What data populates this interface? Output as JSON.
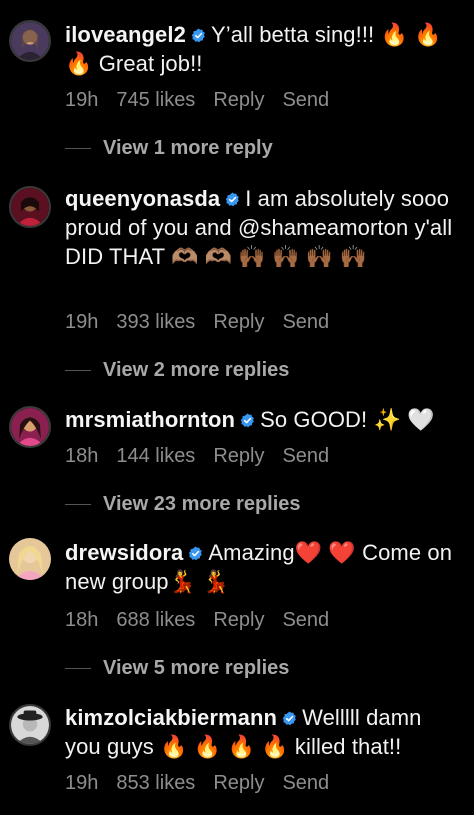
{
  "comments": [
    {
      "username": "iloveangel2",
      "text": "Y’all betta sing!!! 🔥 🔥 🔥 Great job!!",
      "time": "19h",
      "likes": "745 likes",
      "reply": "Reply",
      "send": "Send",
      "view_replies": "View 1 more reply",
      "avatar_colors": [
        "#4a3b5e",
        "#c99a7a"
      ]
    },
    {
      "username": "queenyonasda",
      "text": "I am absolutely sooo proud of you and @shameamorton y'all DID THAT 🫶🏽 🫶🏽 🙌🏾 🙌🏾 🙌🏾 🙌🏾",
      "time": "19h",
      "likes": "393 likes",
      "reply": "Reply",
      "send": "Send",
      "view_replies": "View 2 more replies",
      "avatar_colors": [
        "#5a1020",
        "#e0a070"
      ]
    },
    {
      "username": "mrsmiathornton",
      "text": "So GOOD! ✨ 🤍",
      "time": "18h",
      "likes": "144 likes",
      "reply": "Reply",
      "send": "Send",
      "view_replies": "View 23 more replies",
      "avatar_colors": [
        "#8a2050",
        "#d9a070"
      ]
    },
    {
      "username": "drewsidora",
      "text": "Amazing❤️ ❤️ Come on new group💃 💃",
      "time": "18h",
      "likes": "688 likes",
      "reply": "Reply",
      "send": "Send",
      "view_replies": "View 5 more replies",
      "avatar_colors": [
        "#e6c79a",
        "#f2d6b0"
      ]
    },
    {
      "username": "kimzolciakbiermann",
      "text": "Welllll damn you guys 🔥 🔥 🔥 🔥 killed that!!",
      "time": "19h",
      "likes": "853 likes",
      "reply": "Reply",
      "send": "Send",
      "avatar_colors": [
        "#d8d8d8",
        "#333333"
      ]
    }
  ],
  "colors": {
    "background": "#000000",
    "text": "#f2f2f2",
    "secondary": "#8e8e8e",
    "verified": "#3897f0"
  }
}
